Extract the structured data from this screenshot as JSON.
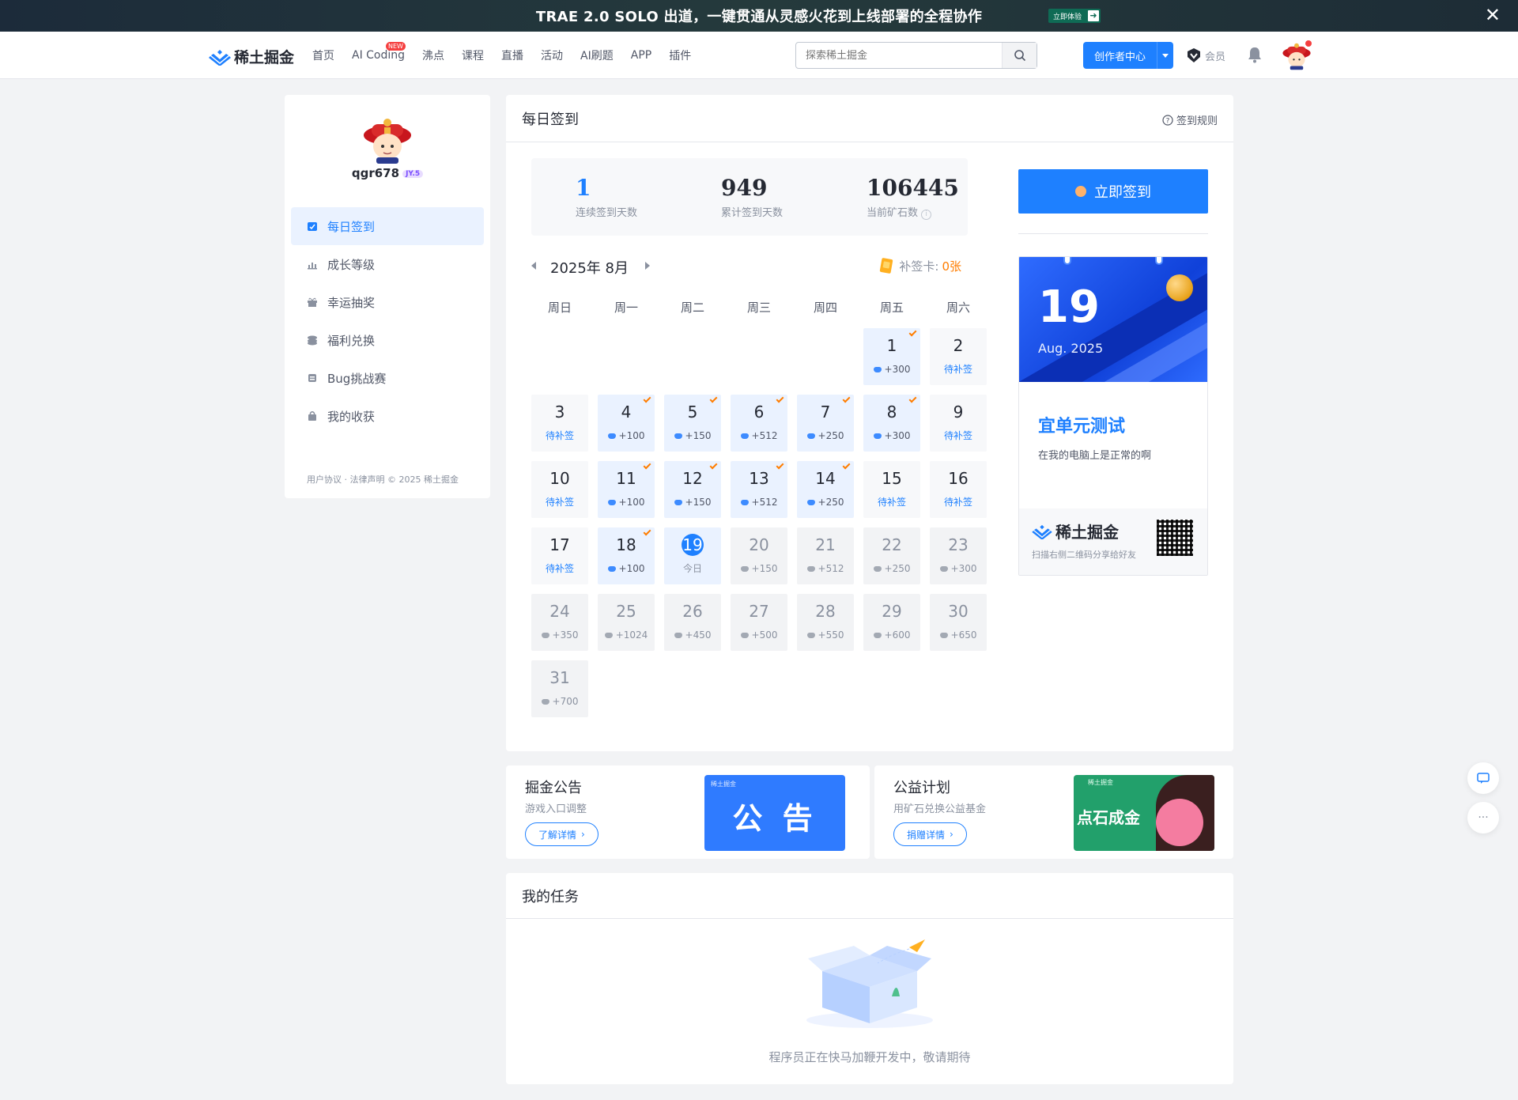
{
  "promo": {
    "text": "TRAE 2.0  SOLO 出道，一键贯通从灵感火花到上线部署的全程协作",
    "button": "立即体验"
  },
  "nav": {
    "logo": "稀土掘金",
    "items": [
      "首页",
      "AI Coding",
      "沸点",
      "课程",
      "直播",
      "活动",
      "AI刷题",
      "APP",
      "插件"
    ],
    "new_badge": "NEW",
    "search_placeholder": "探索稀土掘金",
    "creator": "创作者中心",
    "vip": "会员"
  },
  "sidebar": {
    "username": "qgr678",
    "level": "JY.5",
    "menu": [
      "每日签到",
      "成长等级",
      "幸运抽奖",
      "福利兑换",
      "Bug挑战赛",
      "我的收获"
    ],
    "footer": "用户协议 · 法律声明 © 2025 稀土掘金"
  },
  "signin": {
    "title": "每日签到",
    "rules": "签到规则",
    "stats": [
      {
        "value": "1",
        "label": "连续签到天数"
      },
      {
        "value": "949",
        "label": "累计签到天数"
      },
      {
        "value": "106445",
        "label": "当前矿石数"
      }
    ],
    "month": "2025年 8月",
    "makeup_label": "补签卡:",
    "makeup_count": "0张",
    "weekdays": [
      "周日",
      "周一",
      "周二",
      "周三",
      "周四",
      "周五",
      "周六"
    ],
    "leading_blanks": 5,
    "days": [
      {
        "day": "1",
        "text": "+300",
        "status": "signed"
      },
      {
        "day": "2",
        "text": "待补签",
        "status": "missed"
      },
      {
        "day": "3",
        "text": "待补签",
        "status": "missed"
      },
      {
        "day": "4",
        "text": "+100",
        "status": "signed"
      },
      {
        "day": "5",
        "text": "+150",
        "status": "signed"
      },
      {
        "day": "6",
        "text": "+512",
        "status": "signed"
      },
      {
        "day": "7",
        "text": "+250",
        "status": "signed"
      },
      {
        "day": "8",
        "text": "+300",
        "status": "signed"
      },
      {
        "day": "9",
        "text": "待补签",
        "status": "missed"
      },
      {
        "day": "10",
        "text": "待补签",
        "status": "missed"
      },
      {
        "day": "11",
        "text": "+100",
        "status": "signed"
      },
      {
        "day": "12",
        "text": "+150",
        "status": "signed"
      },
      {
        "day": "13",
        "text": "+512",
        "status": "signed"
      },
      {
        "day": "14",
        "text": "+250",
        "status": "signed"
      },
      {
        "day": "15",
        "text": "待补签",
        "status": "missed"
      },
      {
        "day": "16",
        "text": "待补签",
        "status": "missed"
      },
      {
        "day": "17",
        "text": "待补签",
        "status": "missed"
      },
      {
        "day": "18",
        "text": "+100",
        "status": "signed"
      },
      {
        "day": "19",
        "text": "今日",
        "status": "today"
      },
      {
        "day": "20",
        "text": "+150",
        "status": "future"
      },
      {
        "day": "21",
        "text": "+512",
        "status": "future"
      },
      {
        "day": "22",
        "text": "+250",
        "status": "future"
      },
      {
        "day": "23",
        "text": "+300",
        "status": "future"
      },
      {
        "day": "24",
        "text": "+350",
        "status": "future"
      },
      {
        "day": "25",
        "text": "+1024",
        "status": "future"
      },
      {
        "day": "26",
        "text": "+450",
        "status": "future"
      },
      {
        "day": "27",
        "text": "+500",
        "status": "future"
      },
      {
        "day": "28",
        "text": "+550",
        "status": "future"
      },
      {
        "day": "29",
        "text": "+600",
        "status": "future"
      },
      {
        "day": "30",
        "text": "+650",
        "status": "future"
      },
      {
        "day": "31",
        "text": "+700",
        "status": "future"
      }
    ],
    "button": "立即签到",
    "card": {
      "day": "19",
      "month": "Aug. 2025",
      "title": "宜单元测试",
      "subtitle": "在我的电脑上是正常的啊",
      "brand": "稀土掘金",
      "share": "扫描右侧二维码分享给好友"
    }
  },
  "announce": {
    "title": "掘金公告",
    "subtitle": "游戏入口调整",
    "button": "了解详情",
    "image_text": "公 告",
    "image_brand": "稀土掘金"
  },
  "charity": {
    "title": "公益计划",
    "subtitle": "用矿石兑换公益基金",
    "button": "捐赠详情",
    "image_text": "点石成金",
    "image_brand": "稀土掘金"
  },
  "tasks": {
    "title": "我的任务",
    "empty": "程序员正在快马加鞭开发中，敬请期待"
  },
  "colors": {
    "accent": "#1e80ff",
    "checkmark": "#ff7d00"
  }
}
